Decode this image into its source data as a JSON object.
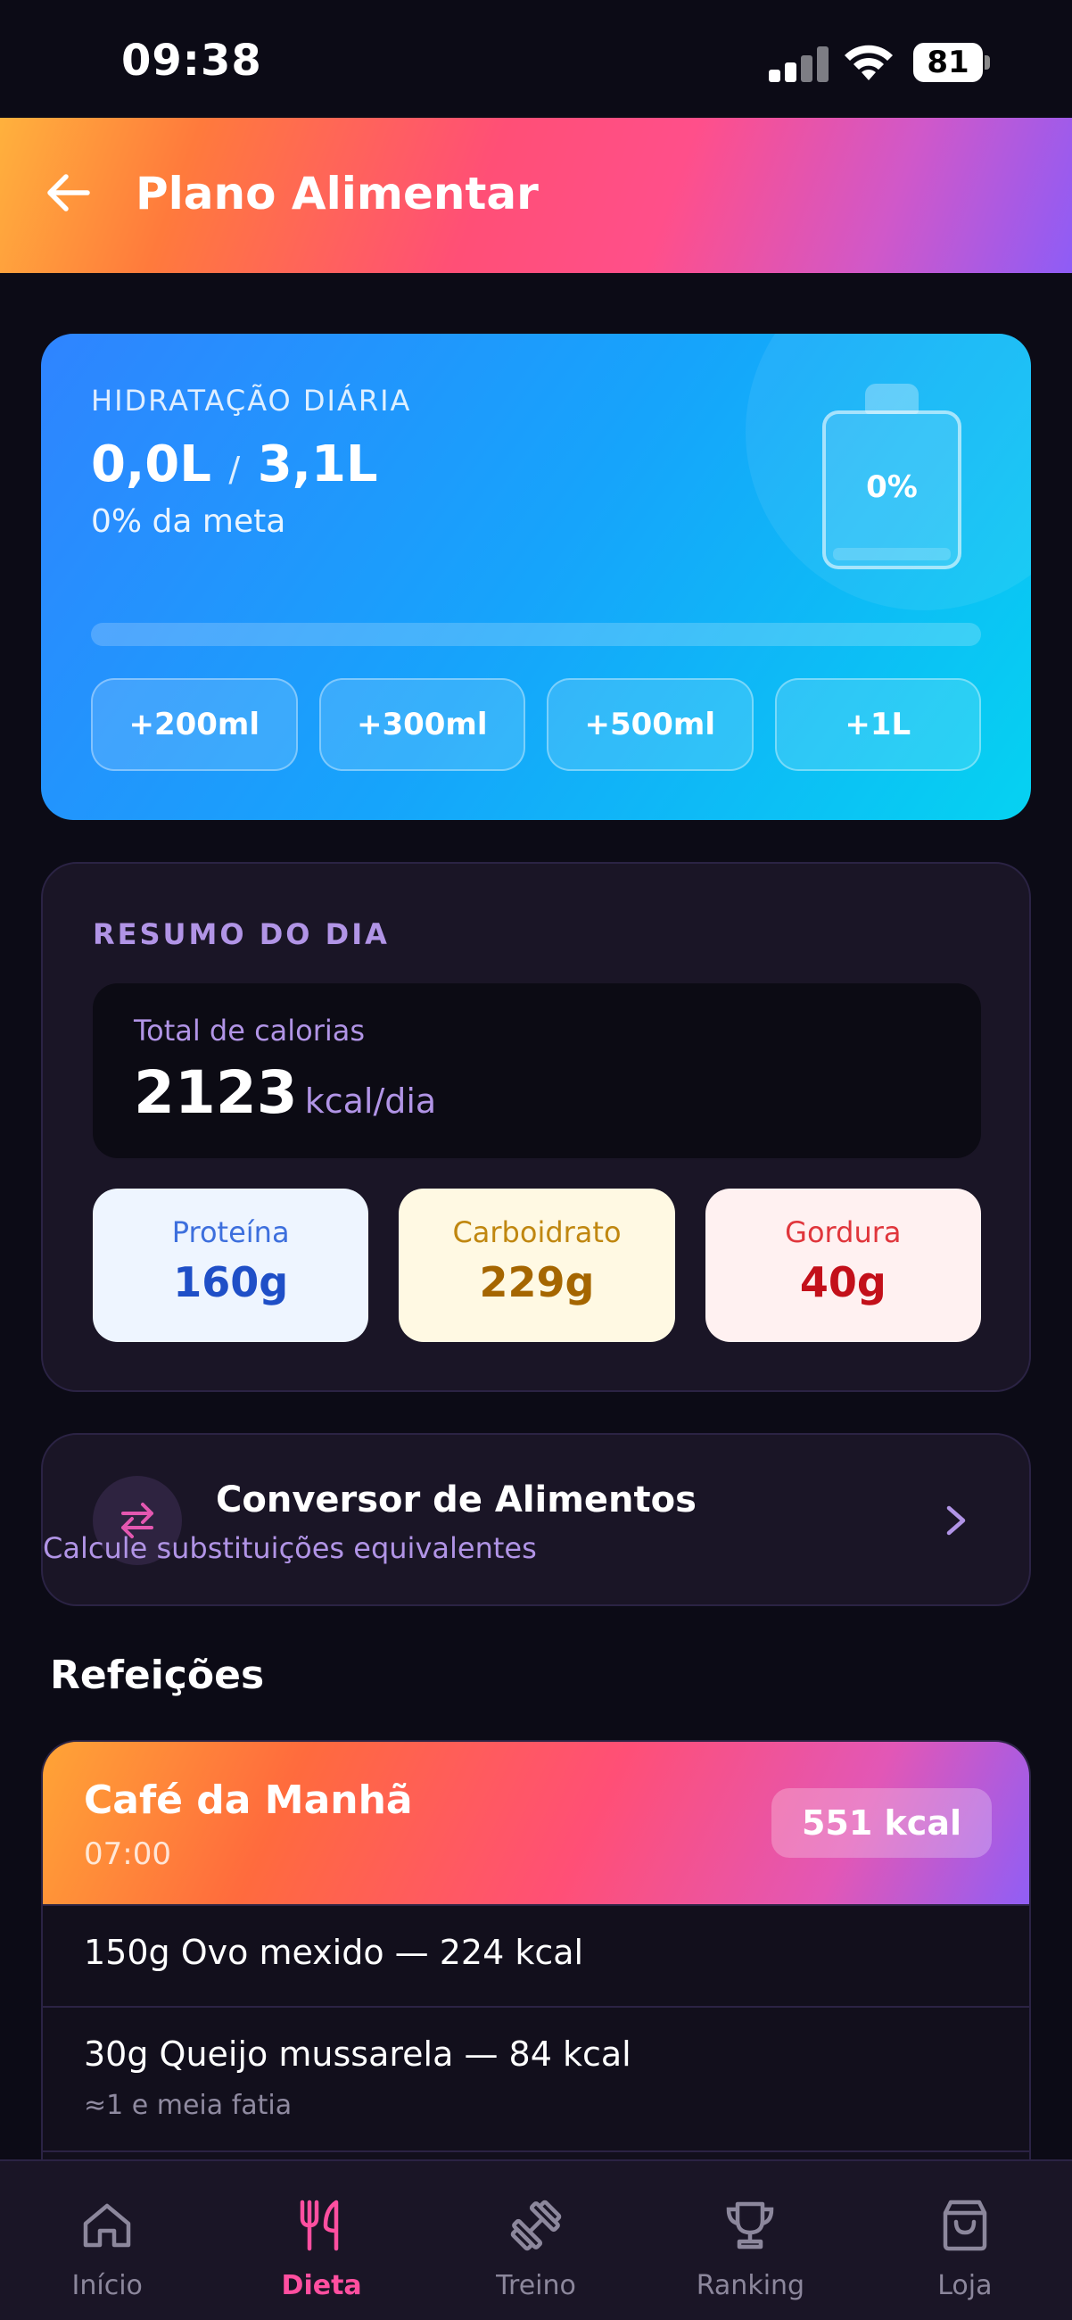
{
  "status_bar": {
    "time": "09:38",
    "battery": "81"
  },
  "header": {
    "title": "Plano Alimentar"
  },
  "hydration": {
    "label": "HIDRATAÇÃO DIÁRIA",
    "current": "0,0L",
    "separator": "/",
    "goal": "3,1L",
    "percent_text": "0% da meta",
    "bottle_percent": "0%",
    "progress_fraction": 0,
    "buttons": [
      "+200ml",
      "+300ml",
      "+500ml",
      "+1L"
    ]
  },
  "summary": {
    "title": "RESUMO DO DIA",
    "calories_label": "Total de calorias",
    "calories_value": "2123",
    "calories_unit": "kcal/dia",
    "macros": [
      {
        "label": "Proteína",
        "value": "160g"
      },
      {
        "label": "Carboidrato",
        "value": "229g"
      },
      {
        "label": "Gordura",
        "value": "40g"
      }
    ]
  },
  "converter": {
    "title": "Conversor de Alimentos",
    "subtitle": "Calcule substituições equivalentes"
  },
  "meals": {
    "title": "Refeições",
    "items": [
      {
        "name": "Café da Manhã",
        "time": "07:00",
        "kcal": "551 kcal",
        "foods": [
          {
            "text": "150g Ovo mexido — 224 kcal",
            "note": ""
          },
          {
            "text": "30g Queijo mussarela — 84 kcal",
            "note": "≈1 e meia fatia"
          }
        ]
      }
    ]
  },
  "nav": {
    "items": [
      {
        "label": "Início",
        "icon": "home-icon"
      },
      {
        "label": "Dieta",
        "icon": "utensils-icon"
      },
      {
        "label": "Treino",
        "icon": "dumbbell-icon"
      },
      {
        "label": "Ranking",
        "icon": "trophy-icon"
      },
      {
        "label": "Loja",
        "icon": "shopping-bag-icon"
      }
    ],
    "active": "Dieta"
  },
  "colors": {
    "background": "#0c0b16",
    "accent_pink": "#ff4fa0",
    "accent_purple": "#b194e6",
    "hydration_blue": "#16a4fb"
  }
}
